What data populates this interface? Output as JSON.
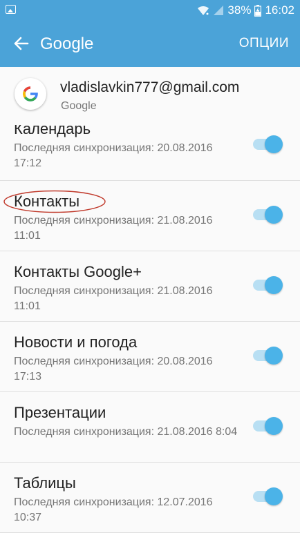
{
  "status_bar": {
    "battery": "38%",
    "time": "16:02"
  },
  "app_bar": {
    "title": "Google",
    "options": "ОПЦИИ"
  },
  "account": {
    "email": "vladislavkin777@gmail.com",
    "provider": "Google"
  },
  "sync_items": [
    {
      "title": "Календарь",
      "status": "Последняя синхронизация: 20.08.2016 17:12",
      "enabled": true
    },
    {
      "title": "Контакты",
      "status": "Последняя синхронизация: 21.08.2016 11:01",
      "enabled": true
    },
    {
      "title": "Контакты Google+",
      "status": "Последняя синхронизация: 21.08.2016 11:01",
      "enabled": true
    },
    {
      "title": "Новости и погода",
      "status": "Последняя синхронизация: 20.08.2016 17:13",
      "enabled": true
    },
    {
      "title": "Презентации",
      "status": "Последняя синхронизация: 21.08.2016 8:04",
      "enabled": true
    },
    {
      "title": "Таблицы",
      "status": "Последняя синхронизация: 12.07.2016 10:37",
      "enabled": true
    }
  ],
  "colors": {
    "accent": "#4ba3d8",
    "toggle_on": "#4bb3e8",
    "annotation": "#c0392b"
  }
}
